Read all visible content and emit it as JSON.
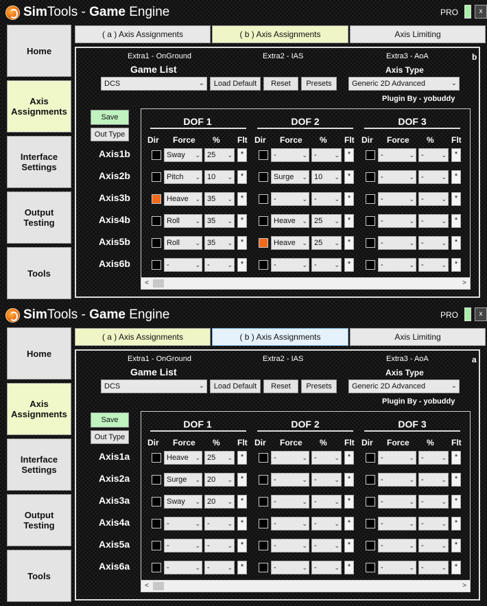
{
  "app": {
    "title_a": "Sim",
    "title_b": "Tools",
    "title_c": " - ",
    "title_d": "Game",
    "title_e": " Engine",
    "pro": "PRO",
    "close": "x"
  },
  "nav": {
    "home": "Home",
    "axis_1": "Axis",
    "axis_2": "Assignments",
    "interface_1": "Interface",
    "interface_2": "Settings",
    "output_1": "Output",
    "output_2": "Testing",
    "tools": "Tools"
  },
  "tabs": {
    "a": "( a ) Axis Assignments",
    "b": "( b ) Axis Assignments",
    "limit": "Axis Limiting"
  },
  "extras": {
    "e1": "Extra1 - OnGround",
    "e2": "Extra2 - IAS",
    "e3": "Extra3 - AoA"
  },
  "labels": {
    "game_list": "Game List",
    "axis_type": "Axis Type",
    "plugin_by": "Plugin By - yobuddy",
    "load_default": "Load Default",
    "reset": "Reset",
    "presets": "Presets",
    "save": "Save",
    "out_type": "Out Type"
  },
  "game": "DCS",
  "axis_type": "Generic 2D Advanced",
  "dof_titles": [
    "DOF 1",
    "DOF 2",
    "DOF 3"
  ],
  "col_headers": {
    "dir": "Dir",
    "force": "Force",
    "pct": "%",
    "flt": "Flt"
  },
  "flt_mark": "*",
  "chevron": "⌄",
  "colors": {
    "checked": "#f26a1b",
    "save_bg": "#bff2bf"
  },
  "windows": [
    {
      "page_letter": "b",
      "rows": [
        {
          "label": "Axis1b",
          "dof": [
            {
              "dir": false,
              "force": "Sway",
              "pct": "25"
            },
            {
              "dir": false,
              "force": "-",
              "pct": "-"
            },
            {
              "dir": false,
              "force": "-",
              "pct": "-"
            }
          ]
        },
        {
          "label": "Axis2b",
          "dof": [
            {
              "dir": false,
              "force": "Pitch",
              "pct": "10"
            },
            {
              "dir": false,
              "force": "Surge",
              "pct": "10"
            },
            {
              "dir": false,
              "force": "-",
              "pct": "-"
            }
          ]
        },
        {
          "label": "Axis3b",
          "dof": [
            {
              "dir": true,
              "force": "Heave",
              "pct": "35"
            },
            {
              "dir": false,
              "force": "-",
              "pct": "-"
            },
            {
              "dir": false,
              "force": "-",
              "pct": "-"
            }
          ]
        },
        {
          "label": "Axis4b",
          "dof": [
            {
              "dir": false,
              "force": "Roll",
              "pct": "35"
            },
            {
              "dir": false,
              "force": "Heave",
              "pct": "25"
            },
            {
              "dir": false,
              "force": "-",
              "pct": "-"
            }
          ]
        },
        {
          "label": "Axis5b",
          "dof": [
            {
              "dir": false,
              "force": "Roll",
              "pct": "35"
            },
            {
              "dir": true,
              "force": "Heave",
              "pct": "25"
            },
            {
              "dir": false,
              "force": "-",
              "pct": "-"
            }
          ]
        },
        {
          "label": "Axis6b",
          "dof": [
            {
              "dir": false,
              "force": "-",
              "pct": "-"
            },
            {
              "dir": false,
              "force": "-",
              "pct": "-"
            },
            {
              "dir": false,
              "force": "-",
              "pct": "-"
            }
          ]
        }
      ]
    },
    {
      "page_letter": "a",
      "rows": [
        {
          "label": "Axis1a",
          "dof": [
            {
              "dir": false,
              "force": "Heave",
              "pct": "25"
            },
            {
              "dir": false,
              "force": "-",
              "pct": "-"
            },
            {
              "dir": false,
              "force": "-",
              "pct": "-"
            }
          ]
        },
        {
          "label": "Axis2a",
          "dof": [
            {
              "dir": false,
              "force": "Surge",
              "pct": "20"
            },
            {
              "dir": false,
              "force": "-",
              "pct": "-"
            },
            {
              "dir": false,
              "force": "-",
              "pct": "-"
            }
          ]
        },
        {
          "label": "Axis3a",
          "dof": [
            {
              "dir": false,
              "force": "Sway",
              "pct": "20"
            },
            {
              "dir": false,
              "force": "-",
              "pct": "-"
            },
            {
              "dir": false,
              "force": "-",
              "pct": "-"
            }
          ]
        },
        {
          "label": "Axis4a",
          "dof": [
            {
              "dir": false,
              "force": "-",
              "pct": "-"
            },
            {
              "dir": false,
              "force": "-",
              "pct": "-"
            },
            {
              "dir": false,
              "force": "-",
              "pct": "-"
            }
          ]
        },
        {
          "label": "Axis5a",
          "dof": [
            {
              "dir": false,
              "force": "-",
              "pct": "-"
            },
            {
              "dir": false,
              "force": "-",
              "pct": "-"
            },
            {
              "dir": false,
              "force": "-",
              "pct": "-"
            }
          ]
        },
        {
          "label": "Axis6a",
          "dof": [
            {
              "dir": false,
              "force": "-",
              "pct": "-"
            },
            {
              "dir": false,
              "force": "-",
              "pct": "-"
            },
            {
              "dir": false,
              "force": "-",
              "pct": "-"
            }
          ]
        }
      ]
    }
  ]
}
